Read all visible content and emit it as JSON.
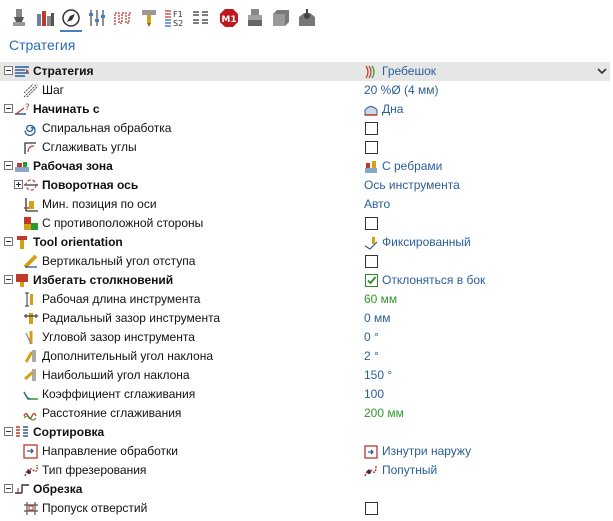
{
  "toolbar": {
    "items": [
      {
        "icon": "tool-holder-icon"
      },
      {
        "icon": "stock-bars-icon"
      },
      {
        "icon": "compass-icon",
        "active": true
      },
      {
        "icon": "sliders-icon"
      },
      {
        "icon": "toolpath-link-icon"
      },
      {
        "icon": "drill-tool-icon"
      },
      {
        "icon": "feed-speed-icon",
        "text_top": "F1",
        "text_bottom": "S2"
      },
      {
        "icon": "nc-code-icon"
      },
      {
        "icon": "m1-stop-icon",
        "text": "M1"
      },
      {
        "icon": "machine-head-icon"
      },
      {
        "icon": "stock-box-icon"
      },
      {
        "icon": "simulation-icon"
      }
    ]
  },
  "page": {
    "heading": "Стратегия"
  },
  "rows": [
    {
      "label": "Стратегия",
      "value": "Гребешок"
    },
    {
      "label": "Шаг",
      "value": "20 %Ø (4 мм)"
    },
    {
      "label": "Начинать с",
      "value": "Дна"
    },
    {
      "label": "Спиральная обработка"
    },
    {
      "label": "Сглаживать углы"
    },
    {
      "label": "Рабочая зона",
      "value": "С ребрами"
    },
    {
      "label": "Поворотная ось",
      "value": "Ось инструмента"
    },
    {
      "label": "Мин. позиция по оси",
      "value": "Авто"
    },
    {
      "label": "С противоположной стороны"
    },
    {
      "label": "Tool orientation",
      "value": "Фиксированный"
    },
    {
      "label": "Вертикальный угол отступа"
    },
    {
      "label": "Избегать столкновений",
      "value": "Отклоняться в бок"
    },
    {
      "label": "Рабочая длина инструмента",
      "value": "60 мм"
    },
    {
      "label": "Радиальный зазор инструмента",
      "value": "0 мм"
    },
    {
      "label": "Угловой зазор инструмента",
      "value": "0 °"
    },
    {
      "label": "Дополнительный угол наклона",
      "value": "2 °"
    },
    {
      "label": "Наибольший угол наклона",
      "value": "150 °"
    },
    {
      "label": "Коэффициент сглаживания",
      "value": "100"
    },
    {
      "label": "Расстояние сглаживания",
      "value": "200 мм"
    },
    {
      "label": "Сортировка"
    },
    {
      "label": "Направление обработки",
      "value": "Изнутри наружу"
    },
    {
      "label": "Тип фрезерования",
      "value": "Попутный"
    },
    {
      "label": "Обрезка"
    },
    {
      "label": "Пропуск отверстий"
    }
  ],
  "colors": {
    "value_blue": "#2a5e9a",
    "value_green": "#2a9a2a",
    "heading_blue": "#2a6db3",
    "highlight": "#e6e6e6"
  }
}
